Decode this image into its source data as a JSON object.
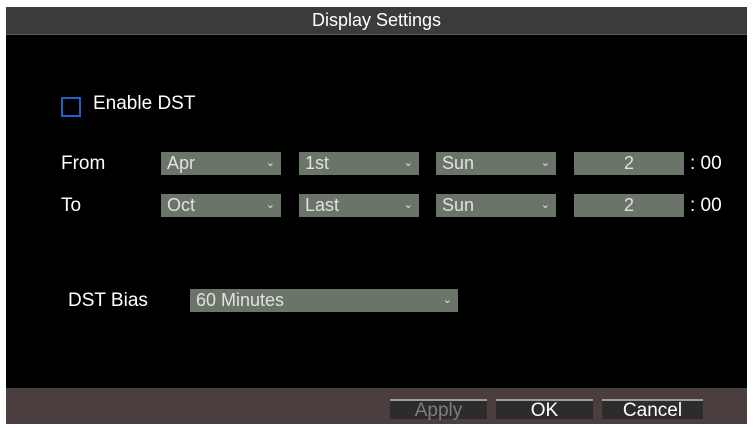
{
  "window": {
    "title": "Display Settings"
  },
  "dst": {
    "enable_label": "Enable DST",
    "enabled": false,
    "from": {
      "label": "From",
      "month": "Apr",
      "week": "1st",
      "day": "Sun",
      "hour": "2",
      "suffix": ": 00"
    },
    "to": {
      "label": "To",
      "month": "Oct",
      "week": "Last",
      "day": "Sun",
      "hour": "2",
      "suffix": ": 00"
    },
    "bias_label": "DST Bias",
    "bias_value": "60 Minutes"
  },
  "buttons": {
    "apply": "Apply",
    "ok": "OK",
    "cancel": "Cancel"
  },
  "icons": {
    "dropdown": "chevron-down-icon"
  },
  "colors": {
    "checkbox_border": "#1e63c8",
    "dropdown_bg": "#6b7469",
    "footer_bg": "#4a3f3e"
  }
}
